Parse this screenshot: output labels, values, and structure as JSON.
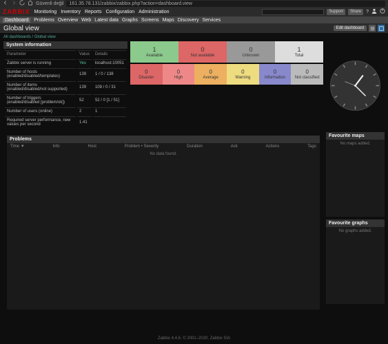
{
  "browser": {
    "security": "Güvenli değil",
    "url": "161.35.78.131/zabbix/zabbix.php?action=dashboard.view"
  },
  "topnav": {
    "logo": "ZABBIX",
    "items": [
      "Monitoring",
      "Inventory",
      "Reports",
      "Configuration",
      "Administration"
    ],
    "support": "Support",
    "share": "Share"
  },
  "subnav": [
    "Dashboard",
    "Problems",
    "Overview",
    "Web",
    "Latest data",
    "Graphs",
    "Screens",
    "Maps",
    "Discovery",
    "Services"
  ],
  "page": {
    "title": "Global view",
    "edit": "Edit dashboard",
    "crumb1": "All dashboards",
    "crumb2": "Global view"
  },
  "sysinfo": {
    "title": "System information",
    "hParam": "Parameter",
    "hVal": "Value",
    "hDet": "Details",
    "rows": [
      {
        "p": "Zabbix server is running",
        "v": "Yes",
        "vclass": "yes",
        "d": "localhost:10051"
      },
      {
        "p": "Number of hosts (enabled/disabled/templates)",
        "v": "139",
        "d": "1 / 0 / 138"
      },
      {
        "p": "Number of items (enabled/disabled/not supported)",
        "v": "139",
        "d": "108 / 0 / 31"
      },
      {
        "p": "Number of triggers (enabled/disabled [problem/ok])",
        "v": "52",
        "d": "52 / 0 [1 / 51]"
      },
      {
        "p": "Number of users (online)",
        "v": "2",
        "d": "1"
      },
      {
        "p": "Required server performance, new values per second",
        "v": "1.41",
        "d": ""
      }
    ]
  },
  "status": {
    "row1": [
      {
        "n": "1",
        "l": "Available",
        "c": "#8cc98c"
      },
      {
        "n": "0",
        "l": "Not available",
        "c": "#d66"
      },
      {
        "n": "0",
        "l": "Unknown",
        "c": "#999"
      },
      {
        "n": "1",
        "l": "Total",
        "c": "#ddd"
      }
    ],
    "row2": [
      {
        "n": "0",
        "l": "Disaster",
        "c": "#d66"
      },
      {
        "n": "0",
        "l": "High",
        "c": "#e88"
      },
      {
        "n": "0",
        "l": "Average",
        "c": "#ecb060"
      },
      {
        "n": "0",
        "l": "Warning",
        "c": "#eedc80"
      },
      {
        "n": "0",
        "l": "Information",
        "c": "#88c"
      },
      {
        "n": "0",
        "l": "Not classified",
        "c": "#bbb"
      }
    ]
  },
  "problems": {
    "title": "Problems",
    "cols": [
      "Time ▼",
      "Info",
      "Host",
      "Problem • Severity",
      "Duration",
      "Ack",
      "Actions",
      "Tags"
    ],
    "nodata": "No data found."
  },
  "favmaps": {
    "title": "Favourite maps",
    "msg": "No maps added."
  },
  "favgraphs": {
    "title": "Favourite graphs",
    "msg": "No graphs added."
  },
  "footer": "Zabbix 4.4.6. © 2001–2020, Zabbix SIA"
}
